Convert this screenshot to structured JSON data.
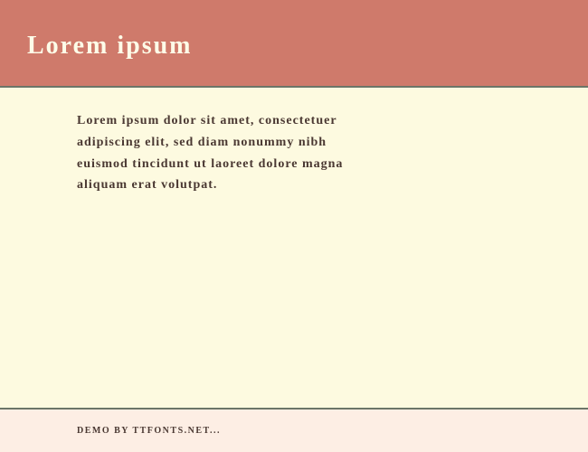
{
  "header": {
    "title": "Lorem ipsum"
  },
  "content": {
    "body": "Lorem ipsum dolor sit amet, consectetuer adipiscing elit, sed diam nonummy nibh euismod tincidunt ut laoreet dolore magna aliquam erat volutpat."
  },
  "footer": {
    "text": "DEMO BY TTFONTS.NET..."
  }
}
